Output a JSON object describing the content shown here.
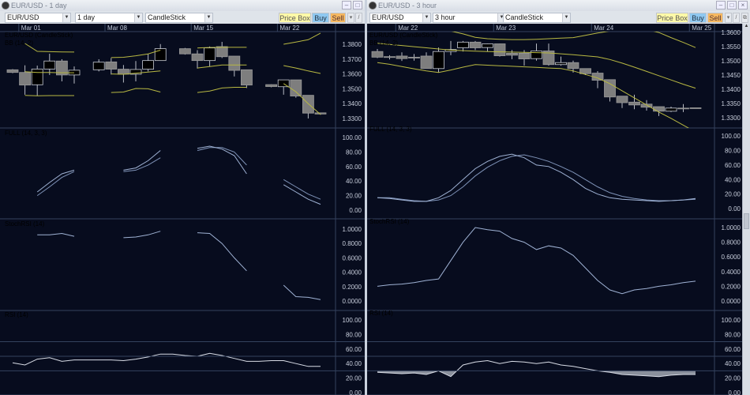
{
  "windows": [
    {
      "title": "EUR/USD - 1 day",
      "symbol": "EUR/USD",
      "period": "1 day",
      "style": "CandleStick",
      "buttons": {
        "price_box": "Price Box",
        "buy": "Buy",
        "sell": "Sell"
      },
      "labels": {
        "price": "EUR/USD (CandleStick)",
        "bb": "BB (14, 2)",
        "full": "FULL (14, 3, 3)",
        "stoch": "StochRSI (14)",
        "rsi": "RSI (14)"
      }
    },
    {
      "title": "EUR/USD - 3 hour",
      "symbol": "EUR/USD",
      "period": "3 hour",
      "style": "CandleStick",
      "buttons": {
        "price_box": "Price Box",
        "buy": "Buy",
        "sell": "Sell"
      },
      "labels": {
        "price": "EUR/USD (CandleStick)",
        "bb": "BB (14, 2)",
        "full": "FULL (14, 3, 3)",
        "stoch": "StochRSI (14)",
        "rsi": "RSI (14)"
      }
    }
  ],
  "colors": {
    "background": "#070c1e",
    "grid": "#34425e",
    "bb": "#b8b842",
    "osc": "#9fb2d4",
    "candle_down": "#7e7e7e",
    "candle_up": "#000000",
    "wick": "#b8bcc4",
    "label_price": "#9aa8c4",
    "label_bb": "#c8c850",
    "label_ind": "#5a78a8"
  },
  "chart_data": [
    {
      "type": "candlestick",
      "timeframe": "1 day",
      "dates": [
        {
          "label": "Mar 01",
          "bar": 0.5
        },
        {
          "label": "Mar 08",
          "bar": 7.5
        },
        {
          "label": "Mar 15",
          "bar": 14.5
        },
        {
          "label": "Mar 22",
          "bar": 21.5
        }
      ],
      "price": {
        "ylim": [
          1.3236,
          1.3885
        ],
        "ticks": [
          1.38,
          1.37,
          1.36,
          1.35,
          1.34,
          1.33
        ],
        "decimals": 4,
        "candles": [
          [
            0,
            1.3628,
            1.3632,
            1.3605,
            1.361
          ],
          [
            1,
            1.361,
            1.3658,
            1.346,
            1.3525
          ],
          [
            2,
            1.3527,
            1.3656,
            1.3451,
            1.3633
          ],
          [
            3,
            1.3633,
            1.3736,
            1.3593,
            1.3687
          ],
          [
            4,
            1.3687,
            1.3699,
            1.355,
            1.3593
          ],
          [
            5,
            1.3593,
            1.365,
            1.3535,
            1.3625
          ],
          [
            7,
            1.3628,
            1.3699,
            1.3617,
            1.3679
          ],
          [
            8,
            1.3681,
            1.3707,
            1.3596,
            1.3632
          ],
          [
            9,
            1.3632,
            1.366,
            1.3542,
            1.3598
          ],
          [
            10,
            1.3598,
            1.3687,
            1.355,
            1.363
          ],
          [
            11,
            1.3632,
            1.3734,
            1.3617,
            1.369
          ],
          [
            12,
            1.369,
            1.3801,
            1.369,
            1.377
          ],
          [
            14,
            1.377,
            1.3775,
            1.373,
            1.3735
          ],
          [
            15,
            1.3735,
            1.376,
            1.3636,
            1.369
          ],
          [
            16,
            1.369,
            1.3785,
            1.365,
            1.3775
          ],
          [
            17,
            1.3784,
            1.3816,
            1.3707,
            1.3716
          ],
          [
            18,
            1.372,
            1.372,
            1.3583,
            1.3624
          ],
          [
            19,
            1.3628,
            1.3628,
            1.3505,
            1.3525
          ],
          [
            21,
            1.3528,
            1.353,
            1.351,
            1.3515
          ],
          [
            22,
            1.3514,
            1.356,
            1.346,
            1.356
          ],
          [
            23,
            1.356,
            1.356,
            1.344,
            1.3451
          ],
          [
            24,
            1.3456,
            1.3456,
            1.33,
            1.3336
          ],
          [
            25,
            1.3338,
            1.334,
            1.3325,
            1.333
          ]
        ],
        "bb": {
          "upper": [
            null,
            1.3805,
            1.3752,
            1.375,
            1.3748,
            1.3747,
            null,
            null,
            1.371,
            1.3712,
            1.3722,
            1.3735,
            1.376,
            null,
            null,
            1.3775,
            1.3778,
            1.3779,
            1.3779,
            1.3779,
            null,
            null,
            1.38,
            1.3815,
            1.383,
            1.3875
          ],
          "middle": [
            null,
            1.3615,
            1.361,
            1.361,
            1.3608,
            1.3608,
            null,
            null,
            1.36,
            1.3598,
            1.3605,
            1.3612,
            1.362,
            null,
            null,
            1.364,
            1.365,
            1.366,
            1.366,
            1.366,
            null,
            null,
            1.3656,
            1.364,
            1.362,
            1.3603
          ],
          "lower": [
            null,
            1.3455,
            1.3453,
            1.3454,
            1.3454,
            1.3454,
            null,
            null,
            1.3475,
            1.3478,
            1.3502,
            1.35,
            1.3478,
            null,
            null,
            1.3475,
            1.3485,
            1.3505,
            1.351,
            1.351,
            null,
            null,
            1.3535,
            1.348,
            1.34,
            1.3327
          ]
        }
      },
      "full": {
        "ylim": [
          -12,
          113
        ],
        "ticks": [
          100,
          80,
          60,
          40,
          20,
          0
        ],
        "decimals": 2,
        "k": [
          null,
          null,
          25,
          38,
          50,
          55,
          null,
          null,
          null,
          55,
          58,
          68,
          82,
          null,
          null,
          85,
          88,
          84,
          75,
          50,
          null,
          null,
          35,
          25,
          15,
          8
        ],
        "d": [
          null,
          null,
          20,
          32,
          45,
          53,
          null,
          null,
          null,
          53,
          55,
          62,
          72,
          null,
          null,
          82,
          86,
          86,
          80,
          62,
          null,
          null,
          42,
          32,
          22,
          15
        ]
      },
      "stochrsi": {
        "ylim": [
          -0.132,
          1.143
        ],
        "ticks": [
          1,
          0.8,
          0.6,
          0.4,
          0.2,
          0
        ],
        "decimals": 4,
        "values": [
          null,
          null,
          0.92,
          0.92,
          0.94,
          0.9,
          null,
          null,
          null,
          0.88,
          0.89,
          0.92,
          0.97,
          null,
          null,
          0.95,
          0.94,
          0.8,
          0.6,
          0.42,
          null,
          null,
          0.22,
          0.06,
          0.05,
          0.02
        ]
      },
      "rsi": {
        "ylim": [
          -3.3,
          113
        ],
        "ticks": [
          100,
          80,
          60,
          40,
          20,
          0
        ],
        "decimals": 2,
        "levels": [
          70,
          50,
          30
        ],
        "values": [
          41,
          38,
          46,
          48,
          43,
          45,
          45,
          45,
          45,
          44,
          46,
          49,
          53,
          53,
          51,
          50,
          54,
          51,
          47,
          43,
          43,
          44,
          44,
          40,
          36,
          36
        ]
      }
    },
    {
      "type": "candlestick",
      "timeframe": "3 hour",
      "dates": [
        {
          "label": "Mar 22",
          "bar": 1.5
        },
        {
          "label": "Mar 23",
          "bar": 9.5
        },
        {
          "label": "Mar 24",
          "bar": 17.5
        },
        {
          "label": "Mar 25",
          "bar": 25.5
        }
      ],
      "price": {
        "ylim": [
          1.3264,
          1.3603
        ],
        "ticks": [
          1.36,
          1.355,
          1.35,
          1.345,
          1.34,
          1.335,
          1.33
        ],
        "decimals": 4,
        "candles": [
          [
            0,
            1.3533,
            1.3542,
            1.351,
            1.3513
          ],
          [
            1,
            1.3515,
            1.352,
            1.3505,
            1.3512
          ],
          [
            2,
            1.3517,
            1.353,
            1.35,
            1.3508
          ],
          [
            3,
            1.3513,
            1.3524,
            1.3501,
            1.351
          ],
          [
            4,
            1.3517,
            1.353,
            1.3473,
            1.3473
          ],
          [
            5,
            1.3473,
            1.3547,
            1.3459,
            1.3533
          ],
          [
            6,
            1.3533,
            1.357,
            1.352,
            1.354
          ],
          [
            7,
            1.3546,
            1.357,
            1.3533,
            1.3566
          ],
          [
            8,
            1.3566,
            1.357,
            1.3538,
            1.3546
          ],
          [
            9,
            1.3547,
            1.3561,
            1.3533,
            1.356
          ],
          [
            10,
            1.356,
            1.3561,
            1.3515,
            1.3518
          ],
          [
            11,
            1.3527,
            1.3538,
            1.3506,
            1.352
          ],
          [
            12,
            1.3527,
            1.3538,
            1.3483,
            1.3507
          ],
          [
            13,
            1.3508,
            1.3561,
            1.3501,
            1.3535
          ],
          [
            14,
            1.3535,
            1.3561,
            1.3483,
            1.3487
          ],
          [
            15,
            1.3487,
            1.3515,
            1.3483,
            1.3494
          ],
          [
            16,
            1.3494,
            1.3501,
            1.3459,
            1.3473
          ],
          [
            17,
            1.3473,
            1.3473,
            1.345,
            1.3455
          ],
          [
            18,
            1.3457,
            1.3464,
            1.3404,
            1.3432
          ],
          [
            19,
            1.3434,
            1.3434,
            1.3357,
            1.3373
          ],
          [
            20,
            1.3376,
            1.3376,
            1.3334,
            1.3353
          ],
          [
            21,
            1.3355,
            1.3381,
            1.333,
            1.3345
          ],
          [
            22,
            1.3348,
            1.3362,
            1.3325,
            1.3337
          ],
          [
            23,
            1.3339,
            1.3339,
            1.3306,
            1.3323
          ],
          [
            24,
            1.3323,
            1.3339,
            1.332,
            1.3334
          ],
          [
            25,
            1.3334,
            1.3348,
            1.332,
            1.3333
          ],
          [
            26,
            1.3335,
            1.3335,
            1.3333,
            1.3333
          ]
        ],
        "bb": {
          "upper": [
            1.364,
            1.3635,
            1.363,
            1.3625,
            1.362,
            1.3612,
            1.3605,
            1.3595,
            1.3583,
            1.3578,
            1.3576,
            1.3575,
            1.3575,
            1.3576,
            1.3578,
            1.358,
            1.3582,
            1.359,
            1.3598,
            1.3605,
            1.362,
            1.362,
            1.361,
            1.36,
            1.3582,
            1.3565,
            1.3547
          ],
          "middle": [
            1.3562,
            1.3558,
            1.3554,
            1.355,
            1.3546,
            1.3542,
            1.3538,
            1.3536,
            1.3534,
            1.3533,
            1.3532,
            1.3531,
            1.353,
            1.3529,
            1.3528,
            1.3525,
            1.3522,
            1.3518,
            1.3514,
            1.3505,
            1.3492,
            1.3478,
            1.3463,
            1.3448,
            1.3433,
            1.3418,
            1.3404
          ],
          "lower": [
            1.3494,
            1.3488,
            1.348,
            1.3472,
            1.3465,
            1.3459,
            1.3468,
            1.3478,
            1.3487,
            1.3485,
            1.3483,
            1.3481,
            1.3479,
            1.3477,
            1.3475,
            1.3473,
            1.3465,
            1.3452,
            1.344,
            1.342,
            1.3395,
            1.337,
            1.3345,
            1.332,
            1.3298,
            1.3274,
            1.325
          ]
        }
      },
      "full": {
        "ylim": [
          -14,
          111
        ],
        "ticks": [
          100,
          80,
          60,
          40,
          20,
          0
        ],
        "decimals": 2,
        "k": [
          15,
          14,
          12,
          10,
          10,
          15,
          25,
          40,
          55,
          65,
          72,
          75,
          70,
          60,
          58,
          50,
          40,
          28,
          20,
          15,
          13,
          12,
          11,
          10,
          11,
          12,
          14
        ],
        "d": [
          15,
          15,
          13,
          11,
          10,
          12,
          18,
          30,
          45,
          57,
          66,
          72,
          74,
          70,
          65,
          58,
          50,
          40,
          30,
          22,
          17,
          14,
          12,
          11,
          11,
          12,
          13
        ]
      },
      "stochrsi": {
        "ylim": [
          -0.129,
          1.118
        ],
        "ticks": [
          1,
          0.8,
          0.6,
          0.4,
          0.2,
          0
        ],
        "decimals": 4,
        "values": [
          0.2,
          0.22,
          0.23,
          0.25,
          0.28,
          0.3,
          0.55,
          0.8,
          1.0,
          0.97,
          0.95,
          0.85,
          0.8,
          0.7,
          0.75,
          0.72,
          0.62,
          0.45,
          0.28,
          0.15,
          0.1,
          0.15,
          0.17,
          0.2,
          0.22,
          0.25,
          0.27
        ]
      },
      "rsi": {
        "ylim": [
          -3.3,
          113
        ],
        "ticks": [
          100,
          80,
          60,
          40,
          20,
          0
        ],
        "decimals": 2,
        "levels": [
          70,
          50,
          30
        ],
        "fill_below": 30,
        "values": [
          28,
          27,
          26,
          27,
          25,
          30,
          22,
          38,
          42,
          44,
          40,
          43,
          42,
          40,
          42,
          38,
          36,
          33,
          30,
          28,
          25,
          24,
          23,
          22,
          24,
          25,
          25
        ]
      }
    }
  ]
}
